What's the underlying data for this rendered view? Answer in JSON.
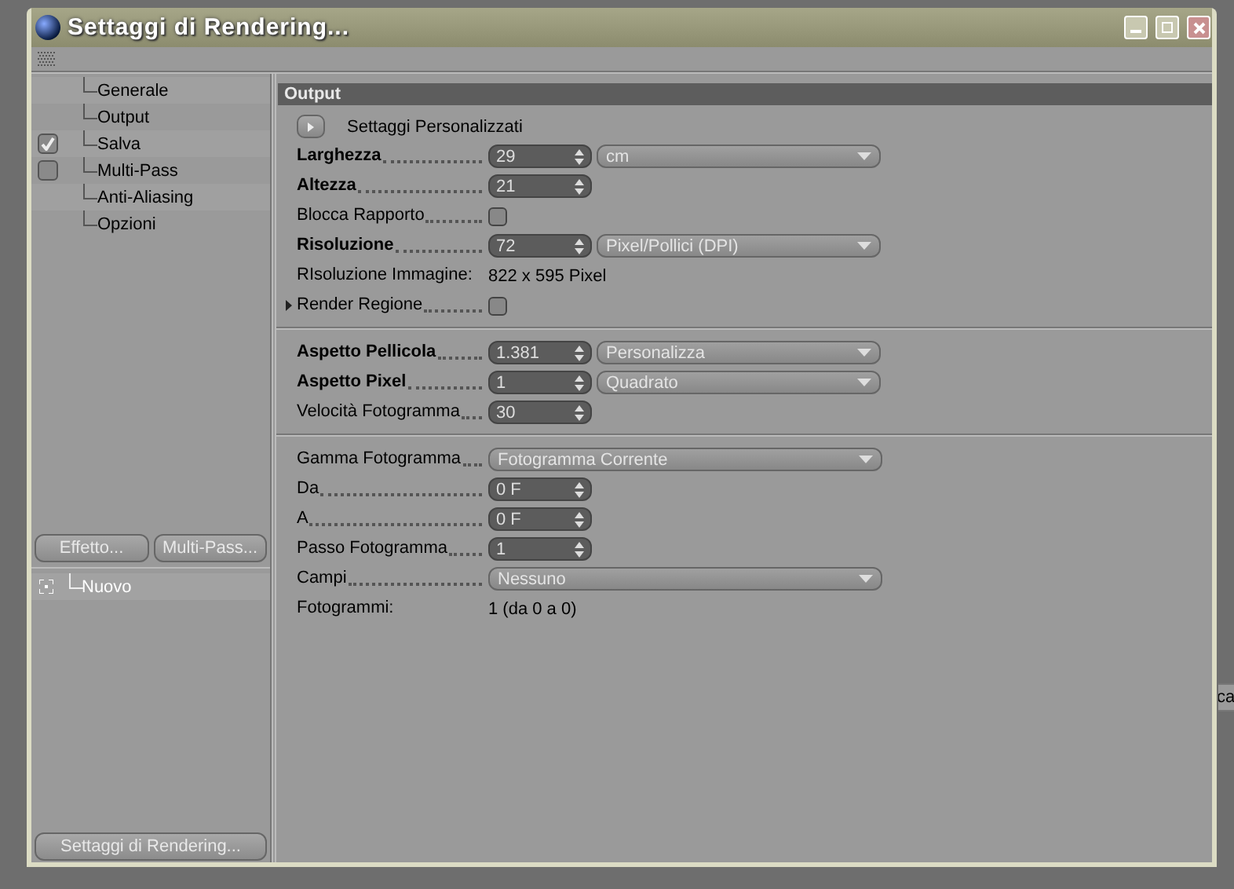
{
  "window": {
    "title": "Settaggi di Rendering..."
  },
  "sidebar": {
    "items": [
      {
        "label": "Generale",
        "kind": "plain"
      },
      {
        "label": "Output",
        "kind": "plain"
      },
      {
        "label": "Salva",
        "kind": "toggle",
        "checked": true
      },
      {
        "label": "Multi-Pass",
        "kind": "toggle",
        "checked": false
      },
      {
        "label": "Anti-Aliasing",
        "kind": "plain"
      },
      {
        "label": "Opzioni",
        "kind": "plain"
      }
    ],
    "buttons": [
      "Effetto...",
      "Multi-Pass..."
    ],
    "effects": [
      {
        "label": "Nuovo"
      }
    ],
    "bottom_button": "Settaggi di Rendering..."
  },
  "panel": {
    "title": "Output",
    "sections": [
      [
        {
          "kind": "button",
          "label": "Settaggi  Personalizzati"
        },
        {
          "kind": "field",
          "label": "Larghezza",
          "bold": true,
          "value": "29",
          "unit": "cm"
        },
        {
          "kind": "field",
          "label": "Altezza",
          "bold": true,
          "value": "21"
        },
        {
          "kind": "checkbox",
          "label": "Blocca Rapporto",
          "checked": false
        },
        {
          "kind": "field",
          "label": "Risoluzione",
          "bold": true,
          "value": "72",
          "unit": "Pixel/Pollici (DPI)"
        },
        {
          "kind": "info",
          "label": "RIsoluzione Immagine:",
          "value": "822 x 595 Pixel"
        },
        {
          "kind": "checkbox",
          "label": "Render Regione",
          "checked": false,
          "expandable": true
        }
      ],
      [
        {
          "kind": "field",
          "label": "Aspetto Pellicola",
          "bold": true,
          "value": "1.381",
          "unit": "Personalizza"
        },
        {
          "kind": "field",
          "label": "Aspetto Pixel",
          "bold": true,
          "value": "1",
          "unit": "Quadrato"
        },
        {
          "kind": "field",
          "label": "Velocità Fotogramma",
          "bold": false,
          "value": "30"
        }
      ],
      [
        {
          "kind": "select",
          "label": "Gamma Fotogramma",
          "value": "Fotogramma Corrente"
        },
        {
          "kind": "field",
          "label": "Da",
          "bold": false,
          "value": "0 F"
        },
        {
          "kind": "field",
          "label": "A",
          "bold": false,
          "value": "0 F"
        },
        {
          "kind": "field",
          "label": "Passo Fotogramma",
          "bold": false,
          "value": "1"
        },
        {
          "kind": "select",
          "label": "Campi",
          "value": "Nessuno"
        },
        {
          "kind": "info",
          "label": "Fotogrammi:",
          "value": "1 (da 0 a 0)"
        }
      ]
    ]
  },
  "background_panel": {
    "text": "ca"
  }
}
